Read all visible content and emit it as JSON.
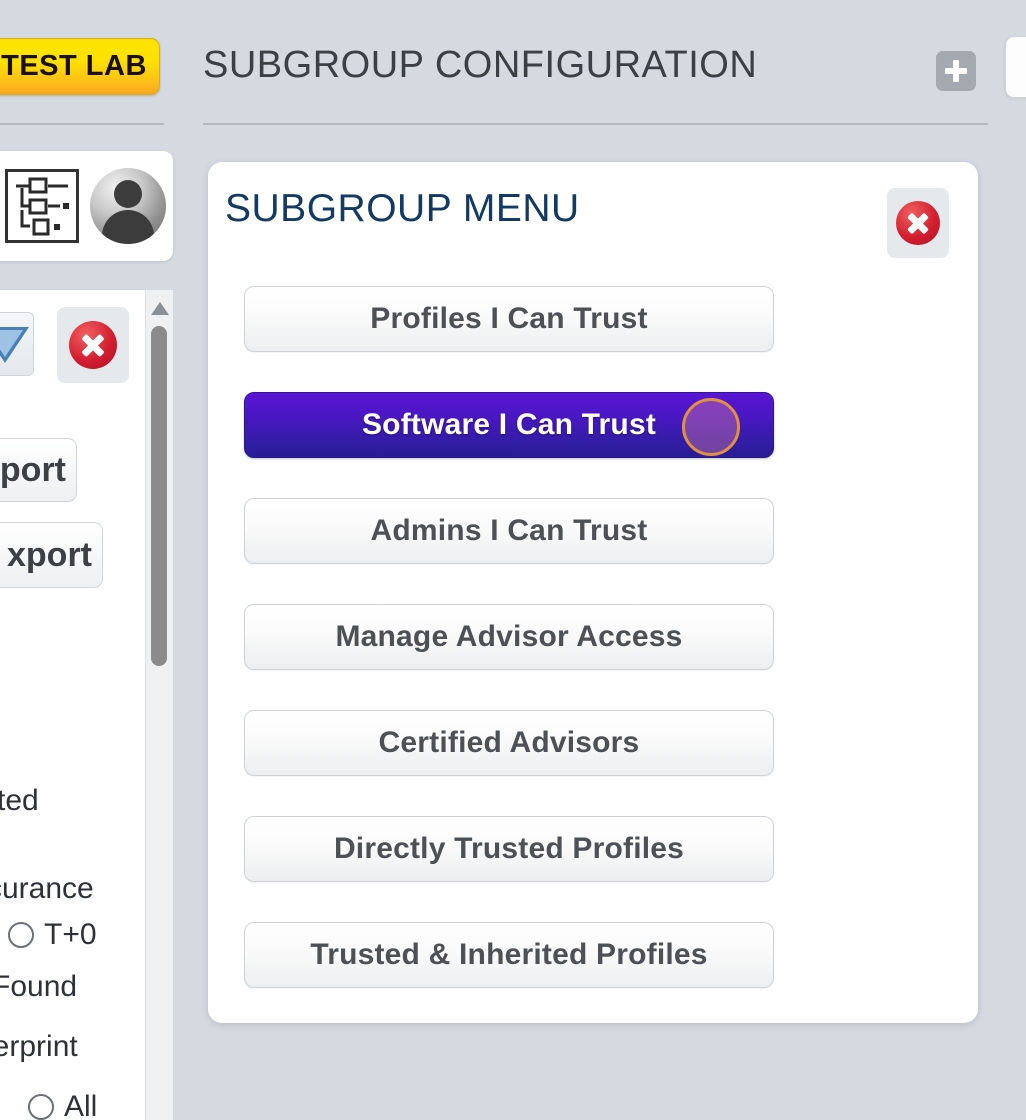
{
  "header": {
    "badge_label": "TEST LAB",
    "title": "SUBGROUP CONFIGURATION",
    "add_icon": "plus-icon"
  },
  "left_panel": {
    "tree_icon": "hierarchy-tree-icon",
    "avatar_icon": "user-avatar-icon",
    "filter_icon": "filter-funnel-icon",
    "close_icon": "close-circle-icon",
    "stub_buttons": [
      {
        "label": "port",
        "name": "import-button"
      },
      {
        "label": "xport",
        "name": "export-button"
      }
    ],
    "texts": {
      "trusted": "sted",
      "occurance": "ccurance",
      "found": "Found",
      "fingerprint": "gerprint"
    },
    "radios": [
      {
        "label": "T+0"
      },
      {
        "label": "All"
      }
    ],
    "scrollbar": {
      "up_arrow_icon": "scroll-up-arrow-icon"
    }
  },
  "dialog": {
    "title": "SUBGROUP MENU",
    "close_icon": "close-circle-icon",
    "items": [
      {
        "label": "Profiles I Can Trust",
        "selected": false
      },
      {
        "label": "Software I Can Trust",
        "selected": true
      },
      {
        "label": "Admins I Can Trust",
        "selected": false
      },
      {
        "label": "Manage Advisor Access",
        "selected": false
      },
      {
        "label": "Certified Advisors",
        "selected": false
      },
      {
        "label": "Directly Trusted Profiles",
        "selected": false
      },
      {
        "label": "Trusted & Inherited Profiles",
        "selected": false
      }
    ]
  },
  "colors": {
    "page_background": "#d5dae1",
    "badge_gradient_start": "#fbe500",
    "badge_gradient_end": "#f9a821",
    "dialog_title": "#123a63",
    "selected_button_start": "#5b14d4",
    "selected_button_end": "#2a1b94",
    "cursor_ring_border": "#e0913f",
    "close_icon_red": "#d31f31"
  }
}
